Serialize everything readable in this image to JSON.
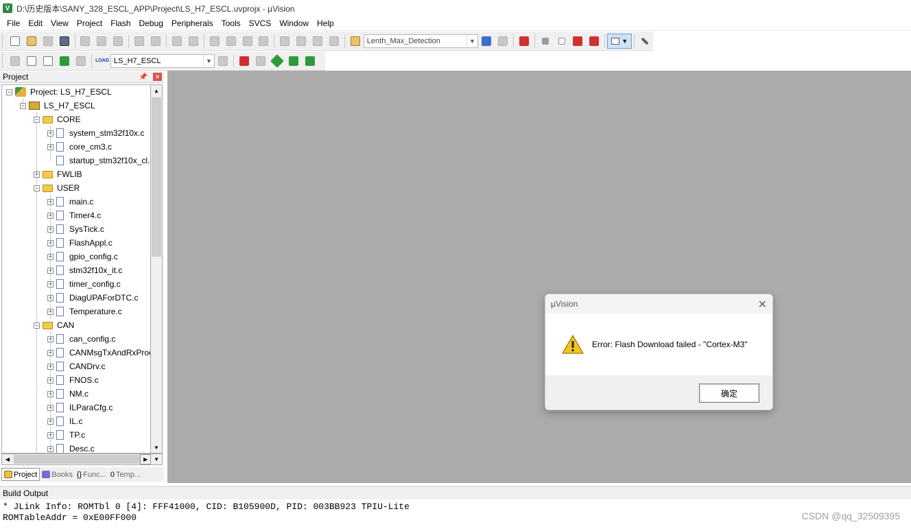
{
  "window": {
    "title": "D:\\历史版本\\SANY_328_ESCL_APP\\Project\\LS_H7_ESCL.uvprojx - µVision"
  },
  "menu": [
    "File",
    "Edit",
    "View",
    "Project",
    "Flash",
    "Debug",
    "Peripherals",
    "Tools",
    "SVCS",
    "Window",
    "Help"
  ],
  "toolbar": {
    "find_combo_value": "Lenth_Max_Detection",
    "target_combo_value": "LS_H7_ESCL",
    "load_label": "LOAD"
  },
  "project_panel": {
    "title": "Project",
    "root": "Project: LS_H7_ESCL",
    "target": "LS_H7_ESCL",
    "groups": {
      "core": {
        "label": "CORE",
        "files": [
          "system_stm32f10x.c",
          "core_cm3.c",
          "startup_stm32f10x_cl."
        ]
      },
      "fwlib": {
        "label": "FWLIB"
      },
      "user": {
        "label": "USER",
        "files": [
          "main.c",
          "Timer4.c",
          "SysTick.c",
          "FlashAppl.c",
          "gpio_config.c",
          "stm32f10x_it.c",
          "timer_config.c",
          "DiagUPAForDTC.c",
          "Temperature.c"
        ]
      },
      "can": {
        "label": "CAN",
        "files": [
          "can_config.c",
          "CANMsgTxAndRxProc",
          "CANDrv.c",
          "FNOS.c",
          "NM.c",
          "ILParaCfg.c",
          "IL.c",
          "TP.c",
          "Desc.c"
        ]
      }
    },
    "tabs": [
      "Project",
      "Books",
      "Func...",
      "Temp..."
    ]
  },
  "dialog": {
    "title": "µVision",
    "message": "Error: Flash Download failed  -  \"Cortex-M3\"",
    "ok_label": "确定"
  },
  "build_output": {
    "title": "Build Output",
    "lines": [
      "* JLink Info: ROMTbl 0 [4]: FFF41000, CID: B105900D, PID: 003BB923 TPIU-Lite",
      "ROMTableAddr = 0xE00FF000"
    ]
  },
  "watermark": "CSDN @qq_32509395",
  "colors": {
    "workspace_bg": "#ababab",
    "toolbar_bg": "#f0f0f0",
    "warning": "#f5c518"
  }
}
